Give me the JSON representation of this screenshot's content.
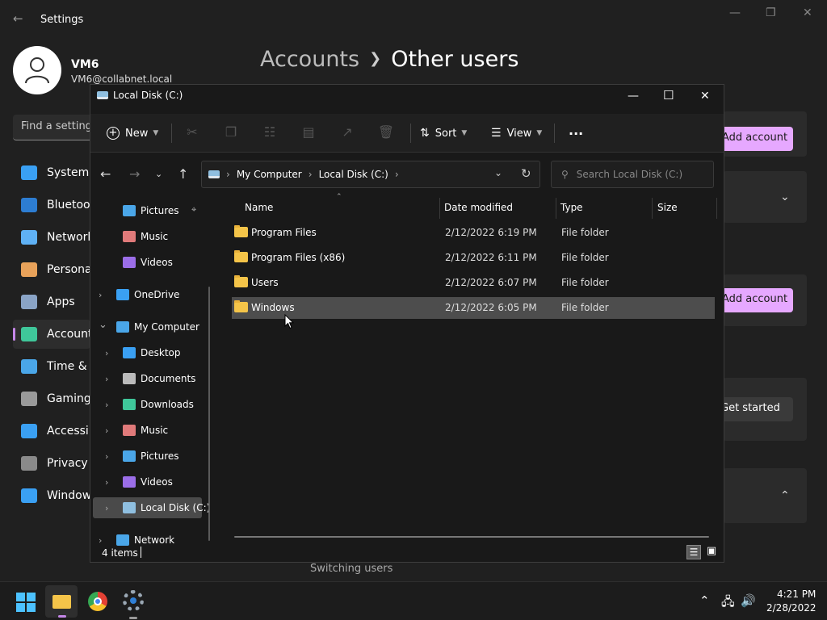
{
  "settings": {
    "title": "Settings",
    "user": {
      "name": "VM6",
      "email": "VM6@collabnet.local"
    },
    "breadcrumb": {
      "parent": "Accounts",
      "current": "Other users"
    },
    "find_placeholder": "Find a setting",
    "nav": [
      {
        "label": "System",
        "color": "#3aa0f3"
      },
      {
        "label": "Bluetooth & devices",
        "color": "#2d7dd2"
      },
      {
        "label": "Network & internet",
        "color": "#5fb1f5"
      },
      {
        "label": "Personalization",
        "color": "#e8a25a"
      },
      {
        "label": "Apps",
        "color": "#8aa4c6"
      },
      {
        "label": "Accounts",
        "color": "#3fc79a"
      },
      {
        "label": "Time & language",
        "color": "#4aa6e8"
      },
      {
        "label": "Gaming",
        "color": "#9a9a9a"
      },
      {
        "label": "Accessibility",
        "color": "#3aa0f3"
      },
      {
        "label": "Privacy & security",
        "color": "#8a8a8a"
      },
      {
        "label": "Windows Update",
        "color": "#3aa0f3"
      }
    ],
    "add_account_label": "Add account",
    "get_started_label": "Get started",
    "switching_users": "Switching users"
  },
  "explorer": {
    "title": "Local Disk (C:)",
    "toolbar": {
      "new_label": "New",
      "sort_label": "Sort",
      "view_label": "View",
      "more_label": "···"
    },
    "address": {
      "crumbs": [
        "My Computer",
        "Local Disk (C:)"
      ]
    },
    "search_placeholder": "Search Local Disk (C:)",
    "tree": [
      {
        "label": "Pictures",
        "color": "#4aa6e8"
      },
      {
        "label": "Music",
        "color": "#e07a7a"
      },
      {
        "label": "Videos",
        "color": "#9b6ee8"
      },
      {
        "label": "OneDrive",
        "color": "#3aa0f3"
      },
      {
        "label": "My Computer",
        "color": "#4aa6e8"
      },
      {
        "label": "Desktop",
        "color": "#3aa0f3"
      },
      {
        "label": "Documents",
        "color": "#bbbbbb"
      },
      {
        "label": "Downloads",
        "color": "#3fc79a"
      },
      {
        "label": "Music",
        "color": "#e07a7a"
      },
      {
        "label": "Pictures",
        "color": "#4aa6e8"
      },
      {
        "label": "Videos",
        "color": "#9b6ee8"
      },
      {
        "label": "Local Disk (C:)",
        "color": "#8fbfe0"
      },
      {
        "label": "Network",
        "color": "#4aa6e8"
      }
    ],
    "columns": {
      "name": "Name",
      "date": "Date modified",
      "type": "Type",
      "size": "Size"
    },
    "rows": [
      {
        "name": "Program Files",
        "date": "2/12/2022 6:19 PM",
        "type": "File folder"
      },
      {
        "name": "Program Files (x86)",
        "date": "2/12/2022 6:11 PM",
        "type": "File folder"
      },
      {
        "name": "Users",
        "date": "2/12/2022 6:07 PM",
        "type": "File folder"
      },
      {
        "name": "Windows",
        "date": "2/12/2022 6:05 PM",
        "type": "File folder"
      }
    ],
    "status": "4 items"
  },
  "taskbar": {
    "time": "4:21 PM",
    "date": "2/28/2022"
  }
}
